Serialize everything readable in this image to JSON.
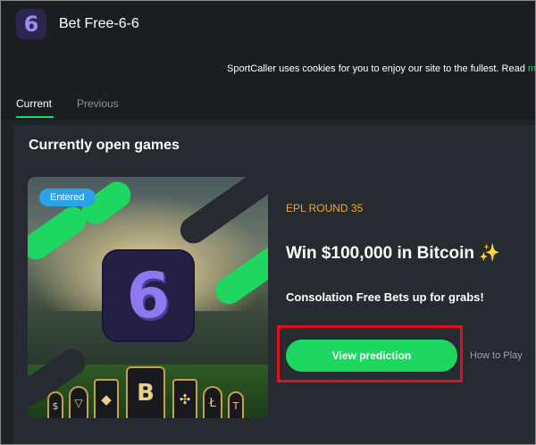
{
  "header": {
    "app_icon_glyph": "6",
    "title": "Bet Free-6-6"
  },
  "cookie": {
    "text": "SportCaller uses cookies for you to enjoy our site to the fullest. Read ",
    "link": "more"
  },
  "tabs": [
    {
      "label": "Current",
      "active": true
    },
    {
      "label": "Previous",
      "active": false
    }
  ],
  "section_title": "Currently open games",
  "game": {
    "badge": "Entered",
    "logo_glyph": "6",
    "coins": [
      "$",
      "▽",
      "◆",
      "B",
      "✣",
      "Ł",
      "T"
    ],
    "round": "EPL ROUND 35",
    "headline": "Win $100,000 in Bitcoin",
    "sparkle": "✨",
    "subline": "Consolation Free Bets up for grabs!",
    "primary_button": "View prediction",
    "secondary_link": "How to Play"
  },
  "colors": {
    "accent_green": "#1ed760",
    "round_orange": "#f5a623",
    "badge_blue": "#2aa3e8",
    "highlight_red": "#d9141c"
  }
}
